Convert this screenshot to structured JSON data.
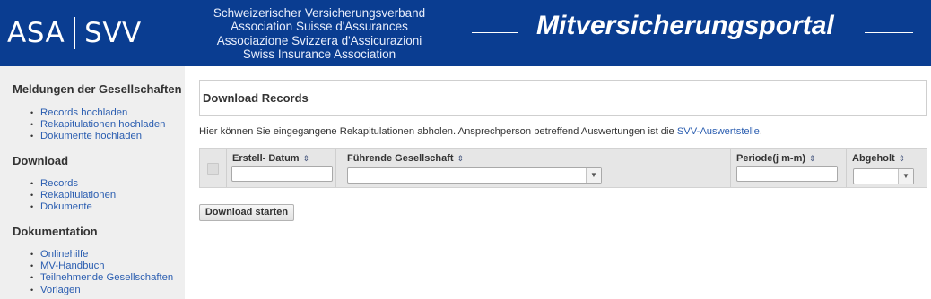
{
  "header": {
    "logo_left": "ASA",
    "logo_right": "SVV",
    "association_names": [
      "Schweizerischer Versicherungsverband",
      "Association Suisse d'Assurances",
      "Associazione Svizzera d'Assicurazioni",
      "Swiss Insurance Association"
    ],
    "portal_title": "Mitversicherungsportal",
    "background_color": "#0a3d91"
  },
  "sidebar": {
    "sections": [
      {
        "heading": "Meldungen der Gesellschaften",
        "items": [
          "Records hochladen",
          "Rekapitulationen hochladen",
          "Dokumente hochladen"
        ]
      },
      {
        "heading": "Download",
        "items": [
          "Records",
          "Rekapitulationen",
          "Dokumente"
        ]
      },
      {
        "heading": "Dokumentation",
        "items": [
          "Onlinehilfe",
          "MV-Handbuch",
          "Teilnehmende Gesellschaften",
          "Vorlagen"
        ]
      }
    ]
  },
  "main": {
    "panel_title": "Download Records",
    "info_text": "Hier können Sie eingegangene Rekapitulationen abholen. Ansprechperson betreffend Auswertungen ist die ",
    "info_link": "SVV-Auswertstelle",
    "info_text_end": ".",
    "grid": {
      "columns": [
        {
          "label": "Erstell- Datum",
          "sort_icon": "sort-icon",
          "filter": "text",
          "value": ""
        },
        {
          "label": "Führende Gesellschaft",
          "sort_icon": "sort-icon",
          "filter": "select",
          "value": ""
        },
        {
          "label": "Periode(j m-m)",
          "sort_icon": "sort-icon",
          "filter": "text",
          "value": ""
        },
        {
          "label": "Abgeholt",
          "sort_icon": "sort-icon",
          "filter": "select",
          "value": ""
        }
      ]
    },
    "download_button": "Download starten"
  },
  "colors": {
    "link": "#2a5db0",
    "sidebar_bg": "#efefef"
  }
}
